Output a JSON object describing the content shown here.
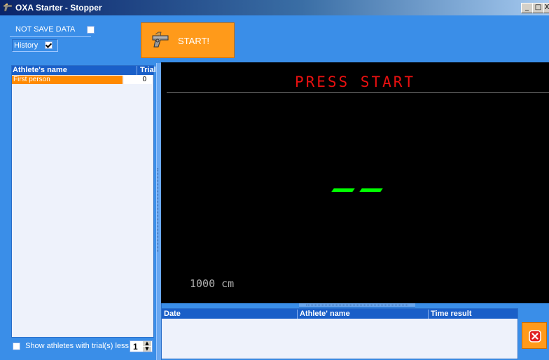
{
  "window": {
    "title": "OXA Starter - Stopper",
    "min_symbol": "_",
    "max_symbol": "□",
    "close_symbol": "X"
  },
  "options": {
    "not_save_label": "NOT SAVE DATA",
    "not_save_checked": false,
    "history_label": "History",
    "history_checked": true
  },
  "start_button": {
    "label": "START!",
    "icon": "starting-pistol-icon"
  },
  "athletes": {
    "columns": [
      "Athlete's name",
      "Trial"
    ],
    "rows": [
      {
        "name": "First person",
        "trial": "0"
      }
    ]
  },
  "filter": {
    "label": "Show athletes with trial(s) less than:",
    "checked": false,
    "value": "1"
  },
  "display": {
    "status": "PRESS START",
    "timer": "--",
    "distance": "1000 cm"
  },
  "results": {
    "columns": [
      "Date",
      "Athlete' name",
      "Time result"
    ]
  },
  "colors": {
    "background": "#3a8ee8",
    "accent": "#ff9a1a",
    "header": "#1a5fc8",
    "display_status": "#e81010",
    "display_timer": "#00ff00"
  }
}
